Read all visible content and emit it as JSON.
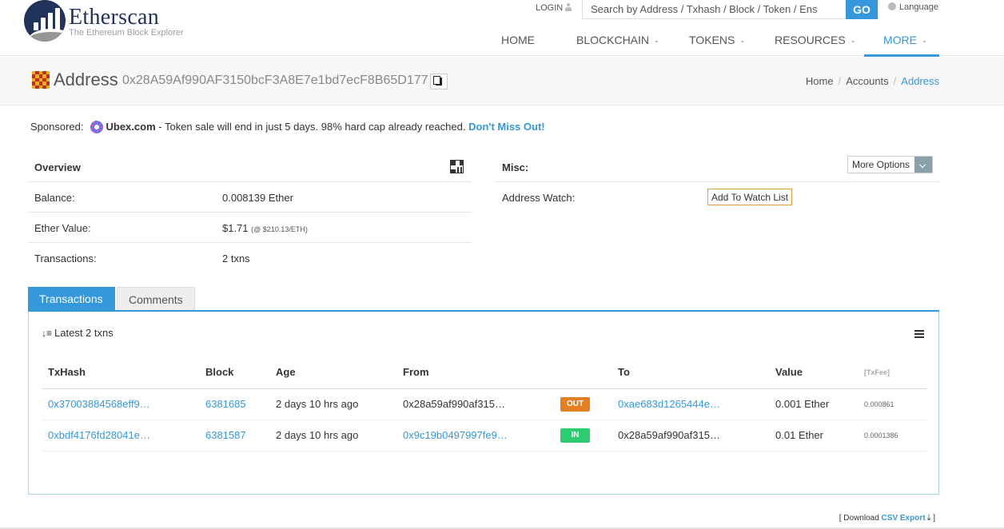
{
  "header": {
    "logo_title": "Etherscan",
    "logo_subtitle": "The Ethereum Block Explorer",
    "login_label": "LOGIN",
    "search_placeholder": "Search by Address / Txhash / Block / Token / Ens",
    "go_label": "GO",
    "language_label": "Language",
    "nav": [
      {
        "label": "HOME"
      },
      {
        "label": "BLOCKCHAIN"
      },
      {
        "label": "TOKENS"
      },
      {
        "label": "RESOURCES"
      },
      {
        "label": "MORE"
      }
    ],
    "brand_color": "#21325b",
    "accent_color": "#3498db"
  },
  "title_bar": {
    "title": "Address",
    "address": "0x28A59Af990AF3150bcF3A8E7e1bd7ecF8B65D177",
    "breadcrumb": [
      "Home",
      "Accounts",
      "Address"
    ]
  },
  "sponsored": {
    "label": "Sponsored:",
    "name": "Ubex.com",
    "text": " - Token sale will end in just 5 days. 98% hard cap already reached. ",
    "cta": "Don't Miss Out!"
  },
  "overview": {
    "heading": "Overview",
    "balance_label": "Balance:",
    "balance_value": "0.008139 Ether",
    "ether_value_label": "Ether Value:",
    "ether_value": "$1.71",
    "ether_value_note": "(@ $210.13/ETH)",
    "transactions_label": "Transactions:",
    "transactions_value": "2 txns"
  },
  "misc": {
    "heading": "Misc:",
    "more_options_label": "More Options",
    "watch_label": "Address Watch:",
    "watch_button": "Add To Watch List"
  },
  "tabs": [
    {
      "label": "Transactions"
    },
    {
      "label": "Comments"
    }
  ],
  "transactions": {
    "summary": "Latest 2 txns",
    "columns": [
      "TxHash",
      "Block",
      "Age",
      "From",
      "",
      "To",
      "Value",
      "[TxFee]"
    ],
    "rows": [
      {
        "hash": "0x37003884568eff9…",
        "block": "6381685",
        "age": "2 days 10 hrs ago",
        "from": "0x28a59af990af315…",
        "direction": "OUT",
        "to": "0xae683d1265444e…",
        "value": "0.001 Ether",
        "fee": "0.000861"
      },
      {
        "hash": "0xbdf4176fd28041e…",
        "block": "6381587",
        "age": "2 days 10 hrs ago",
        "from": "0x9c19b0497997fe9…",
        "direction": "IN",
        "to": "0x28a59af990af315…",
        "value": "0.01 Ether",
        "fee": "0.0001386"
      }
    ]
  },
  "footer": {
    "csv_prefix": "[ Download ",
    "csv_link": "CSV Export",
    "csv_suffix": " ]"
  }
}
